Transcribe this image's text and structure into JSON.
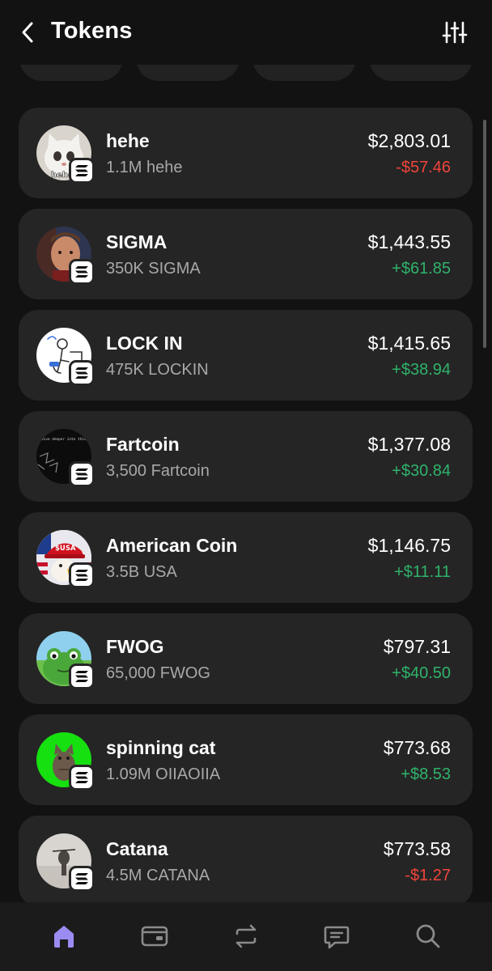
{
  "header": {
    "title": "Tokens",
    "back_icon": "chevron-left-icon",
    "filter_icon": "sliders-icon"
  },
  "colors": {
    "background": "#121212",
    "card": "#252525",
    "positive": "#2fb36b",
    "negative": "#f0443a",
    "tab_active": "#9b8cf2",
    "tab_inactive": "#8a8a8a"
  },
  "tokens": [
    {
      "name": "hehe",
      "amount": "1.1M hehe",
      "value": "$2,803.01",
      "change": "-$57.46",
      "direction": "down",
      "icon": "cat-meme-icon",
      "avatar_text": "hehe"
    },
    {
      "name": "SIGMA",
      "amount": "350K SIGMA",
      "value": "$1,443.55",
      "change": "+$61.85",
      "direction": "up",
      "icon": "sigma-face-icon"
    },
    {
      "name": "LOCK IN",
      "amount": "475K LOCKIN",
      "value": "$1,415.65",
      "change": "+$38.94",
      "direction": "up",
      "icon": "desk-sketch-icon"
    },
    {
      "name": "Fartcoin",
      "amount": "3,500 Fartcoin",
      "value": "$1,377.08",
      "change": "+$30.84",
      "direction": "up",
      "icon": "fartcoin-icon",
      "avatar_text": "dive deeper into this"
    },
    {
      "name": "American Coin",
      "amount": "3.5B USA",
      "value": "$1,146.75",
      "change": "+$11.11",
      "direction": "up",
      "icon": "eagle-cap-icon",
      "avatar_text": "$USA"
    },
    {
      "name": "FWOG",
      "amount": "65,000 FWOG",
      "value": "$797.31",
      "change": "+$40.50",
      "direction": "up",
      "icon": "frog-icon"
    },
    {
      "name": "spinning cat",
      "amount": "1.09M OIIAOIIA",
      "value": "$773.68",
      "change": "+$8.53",
      "direction": "up",
      "icon": "spinning-cat-icon"
    },
    {
      "name": "Catana",
      "amount": "4.5M CATANA",
      "value": "$773.58",
      "change": "-$1.27",
      "direction": "down",
      "icon": "catana-icon"
    }
  ],
  "tabbar": {
    "items": [
      {
        "icon": "home-icon",
        "active": true
      },
      {
        "icon": "wallet-icon",
        "active": false
      },
      {
        "icon": "swap-icon",
        "active": false
      },
      {
        "icon": "chat-icon",
        "active": false
      },
      {
        "icon": "search-icon",
        "active": false
      }
    ]
  }
}
